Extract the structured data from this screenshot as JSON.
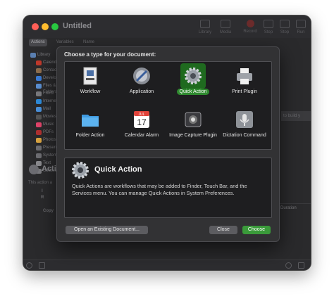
{
  "window": {
    "title": "Untitled",
    "toolbar": [
      "Library",
      "Media",
      "Record",
      "Step",
      "Stop",
      "Run"
    ]
  },
  "subtabs": [
    "Actions",
    "Variables",
    "Name"
  ],
  "sidebar": {
    "library_label": "Library",
    "items": [
      "Calendar",
      "Contacts",
      "Developer",
      "Files & Folders",
      "Fonts",
      "Internet",
      "Mail",
      "Movies",
      "Music",
      "PDFs",
      "Photos",
      "Presentations",
      "System",
      "Text",
      "Utilities"
    ]
  },
  "action_panel": {
    "title": "Action",
    "desc": "This action a",
    "labels": [
      "I",
      "R",
      "Copy"
    ]
  },
  "right_hint": "to build y",
  "duration_label": "Duration",
  "dialog": {
    "heading": "Choose a type for your document:",
    "types": [
      {
        "label": "Workflow",
        "icon": "workflow-icon"
      },
      {
        "label": "Application",
        "icon": "application-icon"
      },
      {
        "label": "Quick Action",
        "icon": "gear-icon"
      },
      {
        "label": "Print Plugin",
        "icon": "printer-icon"
      },
      {
        "label": "Folder Action",
        "icon": "folder-icon"
      },
      {
        "label": "Calendar Alarm",
        "icon": "calendar-icon"
      },
      {
        "label": "Image Capture Plugin",
        "icon": "camera-icon"
      },
      {
        "label": "Dictation Command",
        "icon": "microphone-icon"
      }
    ],
    "calendar_month": "JUL",
    "calendar_day": "17",
    "selected_title": "Quick Action",
    "selected_desc": "Quick Actions are workflows that may be added to Finder, Touch Bar, and the Services menu. You can manage Quick Actions in System Preferences.",
    "buttons": {
      "open": "Open an Existing Document...",
      "close": "Close",
      "choose": "Choose"
    }
  },
  "colors": {
    "accent": "#3a9a3a",
    "background": "#2a2a2c",
    "panel": "#1e1e20"
  }
}
